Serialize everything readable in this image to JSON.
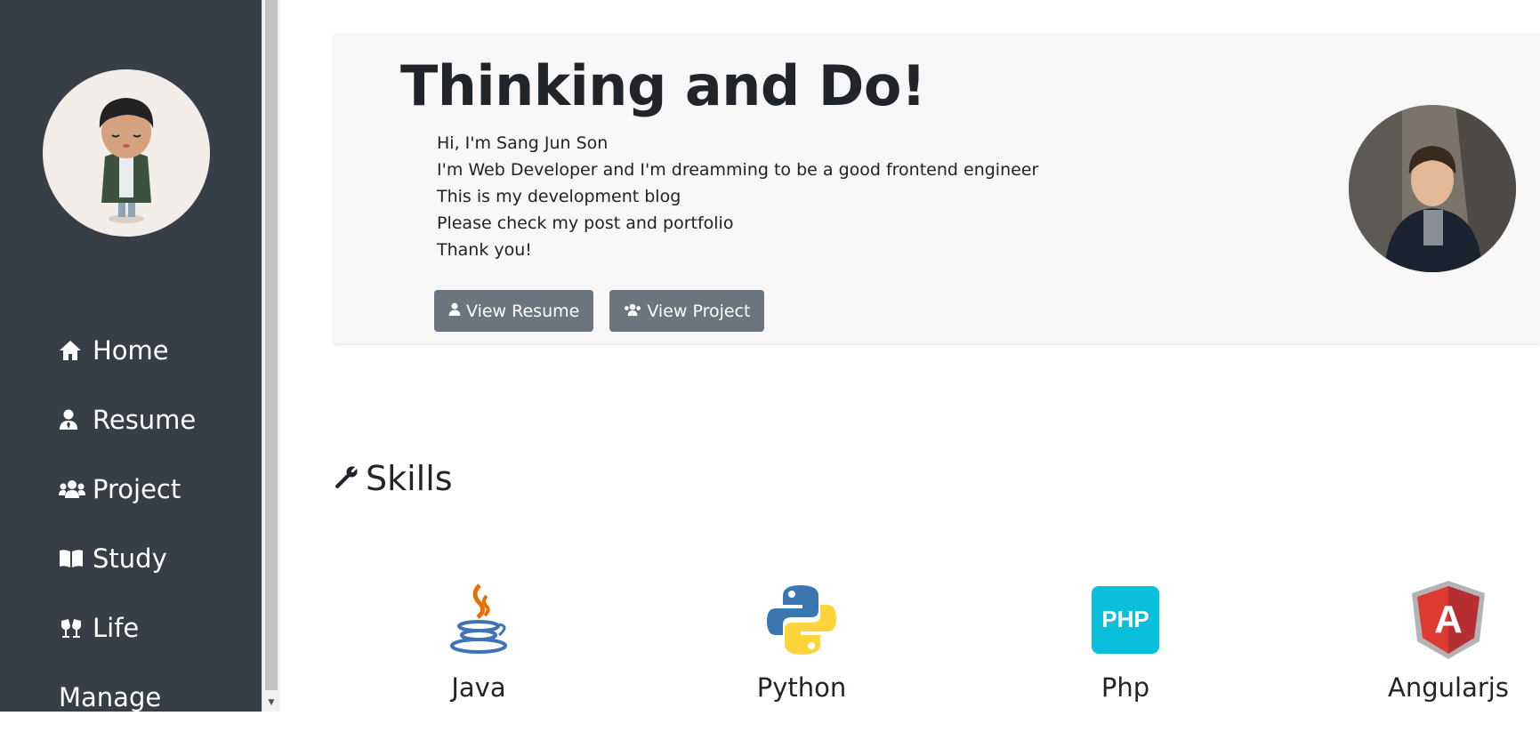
{
  "nav": {
    "items": [
      {
        "label": "Home",
        "icon": "home-icon"
      },
      {
        "label": "Resume",
        "icon": "user-tie-icon"
      },
      {
        "label": "Project",
        "icon": "users-icon"
      },
      {
        "label": "Study",
        "icon": "book-icon"
      },
      {
        "label": "Life",
        "icon": "cheers-icon"
      },
      {
        "label": "Manage",
        "icon": ""
      }
    ]
  },
  "hero": {
    "title": "Thinking and Do!",
    "lines": [
      "Hi, I'm Sang Jun Son",
      "I'm Web Developer and I'm dreamming to be a good frontend engineer",
      "This is my development blog",
      "Please check my post and portfolio",
      "Thank you!"
    ],
    "buttons": {
      "resume": "View Resume",
      "project": "View Project"
    }
  },
  "skills": {
    "heading": "Skills",
    "items": [
      {
        "name": "Java",
        "icon": "java-logo-icon"
      },
      {
        "name": "Python",
        "icon": "python-logo-icon"
      },
      {
        "name": "Php",
        "icon": "php-logo-icon",
        "logo_text": "PHP"
      },
      {
        "name": "Angularjs",
        "icon": "angular-logo-icon",
        "logo_text": "A"
      }
    ]
  },
  "colors": {
    "sidebar_bg": "#373e45",
    "hero_bg": "#f7f7f7",
    "button_bg": "#6c757d",
    "php_brand": "#0abfdc",
    "angular_brand": "#dd3a32"
  }
}
